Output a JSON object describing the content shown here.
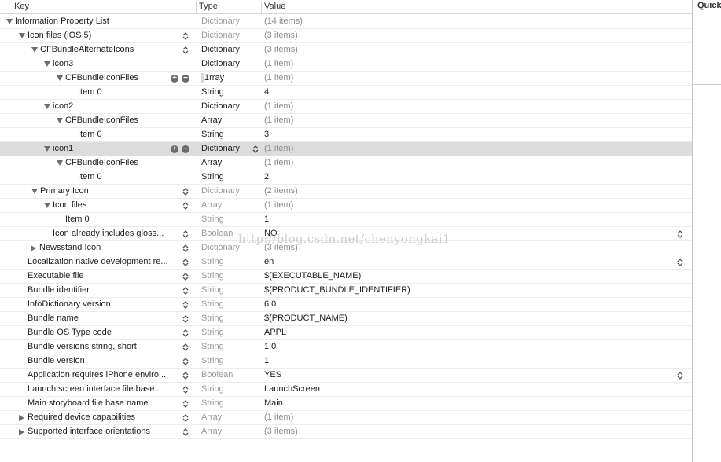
{
  "header": {
    "key_label": "Key",
    "type_label": "Type",
    "value_label": "Value"
  },
  "sidebar": {
    "title": "Quick"
  },
  "watermark": "http://blog.csdn.net/chenyongkai1",
  "typing_caret_text": "1",
  "rows": [
    {
      "key": "Information Property List",
      "type": "Dictionary",
      "value": "(14 items)"
    },
    {
      "key": "Icon files (iOS 5)",
      "type": "Dictionary",
      "value": "(3 items)"
    },
    {
      "key": "CFBundleAlternateIcons",
      "type": "Dictionary",
      "value": "(3 items)"
    },
    {
      "key": "icon3",
      "type": "Dictionary",
      "value": "(1 item)"
    },
    {
      "key": "CFBundleIconFiles",
      "type": "rray",
      "value": "(1 item)"
    },
    {
      "key": "Item 0",
      "type": "String",
      "value": "4"
    },
    {
      "key": "icon2",
      "type": "Dictionary",
      "value": "(1 item)"
    },
    {
      "key": "CFBundleIconFiles",
      "type": "Array",
      "value": "(1 item)"
    },
    {
      "key": "Item 0",
      "type": "String",
      "value": "3"
    },
    {
      "key": "icon1",
      "type": "Dictionary",
      "value": "(1 item)"
    },
    {
      "key": "CFBundleIconFiles",
      "type": "Array",
      "value": "(1 item)"
    },
    {
      "key": "Item 0",
      "type": "String",
      "value": "2"
    },
    {
      "key": "Primary Icon",
      "type": "Dictionary",
      "value": "(2 items)"
    },
    {
      "key": "Icon files",
      "type": "Array",
      "value": "(1 item)"
    },
    {
      "key": "Item 0",
      "type": "String",
      "value": "1"
    },
    {
      "key": "Icon already includes gloss...",
      "type": "Boolean",
      "value": "NO"
    },
    {
      "key": "Newsstand Icon",
      "type": "Dictionary",
      "value": "(3 items)"
    },
    {
      "key": "Localization native development re...",
      "type": "String",
      "value": "en"
    },
    {
      "key": "Executable file",
      "type": "String",
      "value": "$(EXECUTABLE_NAME)"
    },
    {
      "key": "Bundle identifier",
      "type": "String",
      "value": "$(PRODUCT_BUNDLE_IDENTIFIER)"
    },
    {
      "key": "InfoDictionary version",
      "type": "String",
      "value": "6.0"
    },
    {
      "key": "Bundle name",
      "type": "String",
      "value": "$(PRODUCT_NAME)"
    },
    {
      "key": "Bundle OS Type code",
      "type": "String",
      "value": "APPL"
    },
    {
      "key": "Bundle versions string, short",
      "type": "String",
      "value": "1.0"
    },
    {
      "key": "Bundle version",
      "type": "String",
      "value": "1"
    },
    {
      "key": "Application requires iPhone enviro...",
      "type": "Boolean",
      "value": "YES"
    },
    {
      "key": "Launch screen interface file base...",
      "type": "String",
      "value": "LaunchScreen"
    },
    {
      "key": "Main storyboard file base name",
      "type": "String",
      "value": "Main"
    },
    {
      "key": "Required device capabilities",
      "type": "Array",
      "value": "(1 item)"
    },
    {
      "key": "Supported interface orientations",
      "type": "Array",
      "value": "(3 items)"
    }
  ]
}
